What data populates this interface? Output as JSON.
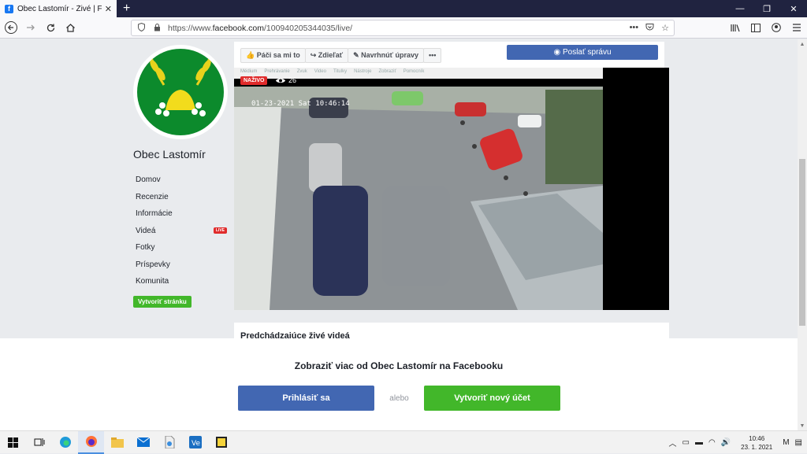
{
  "browser": {
    "tab_title": "Obec Lastomír - Živé | Facebook",
    "favicon_letter": "f",
    "tab_close": "✕",
    "new_tab": "+",
    "url_prefix": "https://www.",
    "url_domain": "facebook.com",
    "url_path": "/100940205344035/live/",
    "url_more": "•••",
    "window_buttons": [
      "—",
      "❐",
      "✕"
    ]
  },
  "page_sidebar": {
    "page_name": "Obec Lastomír",
    "nav_items": [
      {
        "label": "Domov"
      },
      {
        "label": "Recenzie"
      },
      {
        "label": "Informácie"
      },
      {
        "label": "Videá",
        "badge": "LIVE"
      },
      {
        "label": "Fotky"
      },
      {
        "label": "Príspevky"
      },
      {
        "label": "Komunita"
      }
    ],
    "create_page": "Vytvoriť stránku"
  },
  "actions": {
    "like": "Páči sa mi to",
    "share": "Zdieľať",
    "suggest": "Navrhnúť úpravy",
    "more": "•••",
    "message": "Poslať správu"
  },
  "video": {
    "menu": [
      "Médium",
      "Prehrávanie",
      "Zvuk",
      "Video",
      "Titulky",
      "Nástroje",
      "Zobraziť",
      "Pomocník"
    ],
    "live_badge": "NAŽIVO",
    "viewers": "26",
    "timestamp": "01-23-2021 Sat 10:46:14"
  },
  "previous_videos": {
    "title": "Predchádzajúce živé videá"
  },
  "login_overlay": {
    "title": "Zobraziť viac od Obec Lastomír na Facebooku",
    "login": "Prihlásiť sa",
    "or": "alebo",
    "signup": "Vytvoriť nový účet"
  },
  "taskbar": {
    "time": "10:46",
    "date": "23. 1. 2021"
  },
  "colors": {
    "facebook_blue": "#4267b2",
    "green": "#42b72a",
    "live_red": "#e02b2b"
  }
}
